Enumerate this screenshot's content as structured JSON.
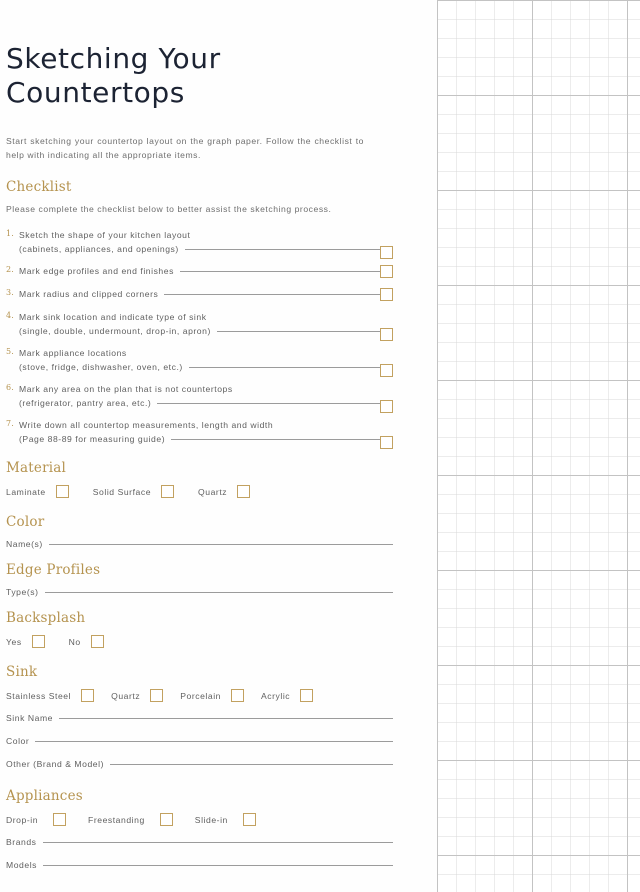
{
  "document": {
    "title": "Sketching Your Countertops",
    "intro": "Start sketching your countertop layout on the graph paper. Follow the checklist to help with indicating all the appropriate items."
  },
  "colors": {
    "heading_gold": "#b5934f",
    "checkbox_border": "#c2a160",
    "title_navy": "#1c2333",
    "body_gray": "#5f5f5f",
    "rule_gray": "#9b9b9b",
    "grid_minor": "#d8d8d8",
    "grid_major": "#c3c3c3"
  },
  "checklist": {
    "heading": "Checklist",
    "note": "Please complete the checklist below to better assist the sketching process.",
    "items": [
      {
        "number": "1.",
        "line1": "Sketch the shape of your kitchen layout",
        "line2": "(cabinets, appliances, and openings)"
      },
      {
        "number": "2.",
        "line1": "",
        "line2": "Mark edge profiles and end finishes"
      },
      {
        "number": "3.",
        "line1": "",
        "line2": "Mark radius and clipped corners"
      },
      {
        "number": "4.",
        "line1": "Mark sink location and indicate type of sink",
        "line2": "(single, double, undermount, drop-in, apron)"
      },
      {
        "number": "5.",
        "line1": "Mark appliance locations",
        "line2": "(stove, fridge, dishwasher, oven, etc.)"
      },
      {
        "number": "6.",
        "line1": "Mark any area on the plan that is not countertops",
        "line2": "(refrigerator, pantry area, etc.)"
      },
      {
        "number": "7.",
        "line1": "Write down all countertop measurements, length and width",
        "line2": "(Page 88-89 for measuring guide)"
      }
    ]
  },
  "material": {
    "heading": "Material",
    "options": [
      "Laminate",
      "Solid Surface",
      "Quartz"
    ]
  },
  "color": {
    "heading": "Color",
    "field_label": "Name(s)"
  },
  "edge_profiles": {
    "heading": "Edge Profiles",
    "field_label": "Type(s)"
  },
  "backsplash": {
    "heading": "Backsplash",
    "options": [
      "Yes",
      "No"
    ]
  },
  "sink": {
    "heading": "Sink",
    "options": [
      "Stainless Steel",
      "Quartz",
      "Porcelain",
      "Acrylic"
    ],
    "fields": [
      "Sink Name",
      "Color",
      "Other (Brand & Model)"
    ]
  },
  "appliances": {
    "heading": "Appliances",
    "options": [
      "Drop-in",
      "Freestanding",
      "Slide-in"
    ],
    "fields": [
      "Brands",
      "Models"
    ]
  }
}
